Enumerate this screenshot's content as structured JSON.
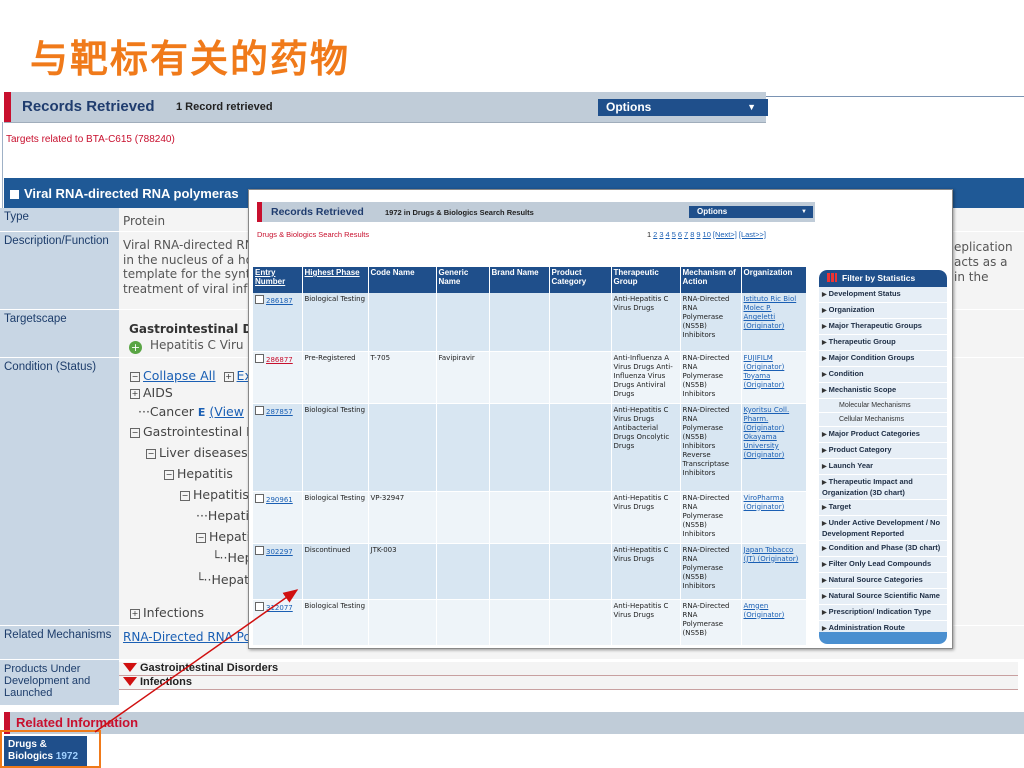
{
  "slide": {
    "title": "与靶标有关的药物"
  },
  "records": {
    "title": "Records Retrieved",
    "count_text": "1 Record retrieved",
    "options_label": "Options",
    "subtitle": "Targets related to BTA-C615 (788240)"
  },
  "section": {
    "title": "Viral RNA-directed RNA polymeras"
  },
  "fields": {
    "type_label": "Type",
    "type_value": "Protein",
    "desc_label": "Description/Function",
    "desc_lines": [
      "Viral RNA-directed RN",
      "in the nucleus of a ho",
      "template for the synt",
      "treatment of viral infe"
    ],
    "desc_right_lines": [
      "eplication",
      "acts as a",
      "in the"
    ],
    "targetscape_label": "Targetscape",
    "targetscape_bold": "Gastrointestinal D",
    "targetscape_sub": "Hepatitis C Viru",
    "condition_label": "Condition (Status)",
    "collapse_all": "Collapse All",
    "expand_all": "Ex",
    "tree": {
      "aids": "AIDS",
      "cancer": "Cancer",
      "cancer_e": "E",
      "cancer_view": "(View",
      "gastro": "Gastrointestinal D",
      "liver": "Liver diseases",
      "hepatitis": "Hepatitis",
      "hepatitis2": "Hepatitis/",
      "hepati_a": "Hepati",
      "hepati_b": "Hepati",
      "hep_c": "Hep",
      "hepati_d": "Hepati",
      "infections": "Infections"
    },
    "related_mech_label": "Related Mechanisms",
    "related_mech_value": "RNA-Directed RNA Po",
    "products_label": "Products Under Development and Launched",
    "products": [
      "Gastrointestinal Disorders",
      "Infections"
    ]
  },
  "related_info": {
    "title": "Related Information",
    "tab_label": "Drugs &",
    "tab_label2": "Biologics",
    "tab_count": "1972"
  },
  "overlay": {
    "bar_title": "Records Retrieved",
    "bar_count": "1972  in Drugs & Biologics Search Results",
    "options_label": "Options",
    "subtitle": "Drugs & Biologics Search Results",
    "pages": [
      "1",
      "2",
      "3",
      "4",
      "5",
      "6",
      "7",
      "8",
      "9",
      "10"
    ],
    "next": "[Next>]",
    "last": "[Last>>]",
    "columns": [
      "Entry Number",
      "Highest Phase",
      "Code Name",
      "Generic Name",
      "Brand Name",
      "Product Category",
      "Therapeutic Group",
      "Mechanism of Action",
      "Organization"
    ],
    "rows": [
      {
        "entry": "286187",
        "phase": "Biological Testing",
        "code": "",
        "generic": "",
        "brand": "",
        "category": "",
        "group": "Anti-Hepatitis C Virus Drugs",
        "mechanism": "RNA-Directed RNA Polymerase (NS5B) Inhibitors",
        "org": "Istituto Ric Biol Molec P. Angeletti (Originator)"
      },
      {
        "entry": "286877",
        "phase": "Pre-Registered",
        "code": "T-705",
        "generic": "Favipiravir",
        "brand": "",
        "category": "",
        "group": "Anti-Influenza A Virus Drugs Anti-Influenza Virus Drugs Antiviral Drugs",
        "mechanism": "RNA-Directed RNA Polymerase (NS5B) Inhibitors",
        "org": "FUJIFILM (Originator) Toyama (Originator)"
      },
      {
        "entry": "287857",
        "phase": "Biological Testing",
        "code": "",
        "generic": "",
        "brand": "",
        "category": "",
        "group": "Anti-Hepatitis C Virus Drugs Antibacterial Drugs Oncolytic Drugs",
        "mechanism": "RNA-Directed RNA Polymerase (NS5B) Inhibitors Reverse Transcriptase Inhibitors",
        "org": "Kyoritsu Coll. Pharm. (Originator) Okayama University (Originator)"
      },
      {
        "entry": "290961",
        "phase": "Biological Testing",
        "code": "VP-32947",
        "generic": "",
        "brand": "",
        "category": "",
        "group": "Anti-Hepatitis C Virus Drugs",
        "mechanism": "RNA-Directed RNA Polymerase (NS5B) Inhibitors",
        "org": "ViroPharma (Originator)"
      },
      {
        "entry": "302297",
        "phase": "Discontinued",
        "code": "JTK-003",
        "generic": "",
        "brand": "",
        "category": "",
        "group": "Anti-Hepatitis C Virus Drugs",
        "mechanism": "RNA-Directed RNA Polymerase (NS5B) Inhibitors",
        "org": "Japan Tobacco (JT) (Originator)"
      },
      {
        "entry": "312077",
        "phase": "Biological Testing",
        "code": "",
        "generic": "",
        "brand": "",
        "category": "",
        "group": "Anti-Hepatitis C Virus Drugs",
        "mechanism": "RNA-Directed RNA Polymerase (NS5B)",
        "org": "Amgen (Originator)"
      }
    ],
    "stats_title": "Filter by Statistics",
    "stats_items": [
      {
        "label": "Development Status"
      },
      {
        "label": "Organization"
      },
      {
        "label": "Major Therapeutic Groups"
      },
      {
        "label": "Therapeutic Group"
      },
      {
        "label": "Major Condition Groups"
      },
      {
        "label": "Condition"
      },
      {
        "label": "Mechanistic Scope",
        "subs": [
          "Molecular Mechanisms",
          "Cellular Mechanisms"
        ]
      },
      {
        "label": "Major Product Categories"
      },
      {
        "label": "Product Category"
      },
      {
        "label": "Launch Year"
      },
      {
        "label": "Therapeutic Impact and Organization (3D chart)"
      },
      {
        "label": "Target"
      },
      {
        "label": "Under Active Development / No Development Reported"
      },
      {
        "label": "Condition and Phase (3D chart)"
      },
      {
        "label": "Filter Only Lead Compounds"
      },
      {
        "label": "Natural Source Categories"
      },
      {
        "label": "Natural Source Scientific Name"
      },
      {
        "label": "Prescription/ Indication Type"
      },
      {
        "label": "Administration Route"
      }
    ]
  },
  "colors": {
    "accent": "#f07a1a",
    "brand_blue": "#1f4f8b",
    "header_red": "#c8102e"
  }
}
